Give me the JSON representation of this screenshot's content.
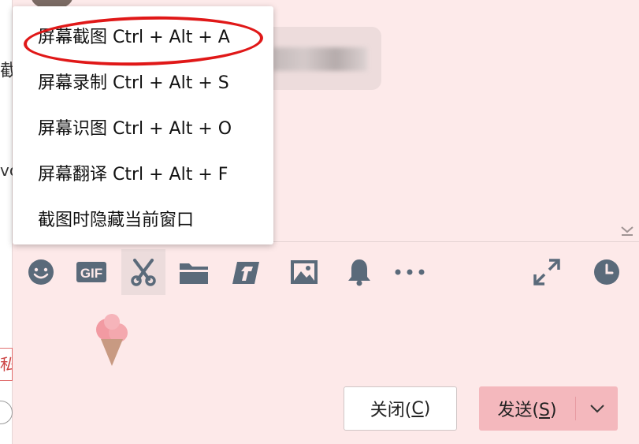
{
  "menu": {
    "items": [
      {
        "label": "屏幕截图 Ctrl + Alt + A"
      },
      {
        "label": "屏幕录制 Ctrl + Alt + S"
      },
      {
        "label": "屏幕识图 Ctrl + Alt + O"
      },
      {
        "label": "屏幕翻译 Ctrl + Alt + F"
      },
      {
        "label": "截图时隐藏当前窗口"
      }
    ],
    "highlighted_index": 0,
    "highlight_color": "#e01818"
  },
  "toolbar": {
    "tools": [
      {
        "icon": "emoji-icon"
      },
      {
        "icon": "gif-icon",
        "label": "GIF"
      },
      {
        "icon": "scissors-icon",
        "active": true
      },
      {
        "icon": "folder-icon"
      },
      {
        "icon": "document-send-icon"
      },
      {
        "icon": "image-icon"
      },
      {
        "icon": "bell-icon"
      },
      {
        "icon": "more-icon"
      },
      {
        "icon": "expand-icon"
      },
      {
        "icon": "history-icon"
      }
    ]
  },
  "chat": {
    "left_fragments": [
      "截",
      "vc",
      "私"
    ]
  },
  "buttons": {
    "close_label": "关闭(",
    "close_key": "C",
    "close_tail": ")",
    "send_label": "发送(",
    "send_key": "S",
    "send_tail": ")"
  },
  "colors": {
    "background": "#fde9e9",
    "send_button": "#f4b8bd",
    "icon": "#5a6a7a"
  }
}
